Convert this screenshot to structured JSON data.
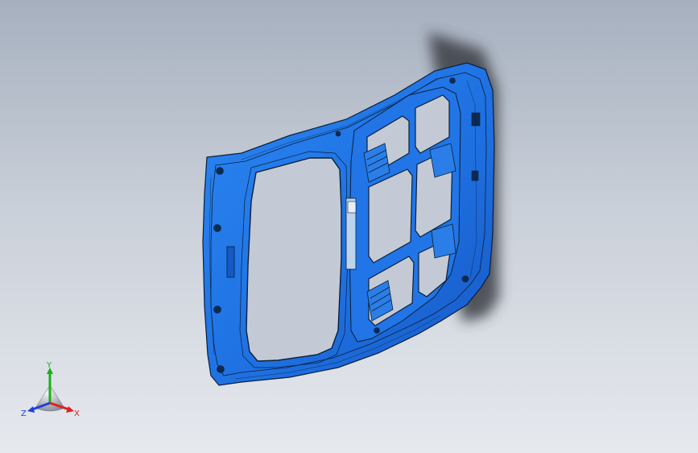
{
  "viewport": {
    "background_top": "#a6b0bf",
    "background_bottom": "#e6e9ee"
  },
  "model": {
    "part_color": "#1f74e6",
    "part_edge_color": "#0b1f3a",
    "shadow_color": "#3a3d44"
  },
  "triad": {
    "x_label": "X",
    "y_label": "Y",
    "z_label": "Z",
    "x_color": "#e02020",
    "y_color": "#18b018",
    "z_color": "#1f3fe0"
  }
}
